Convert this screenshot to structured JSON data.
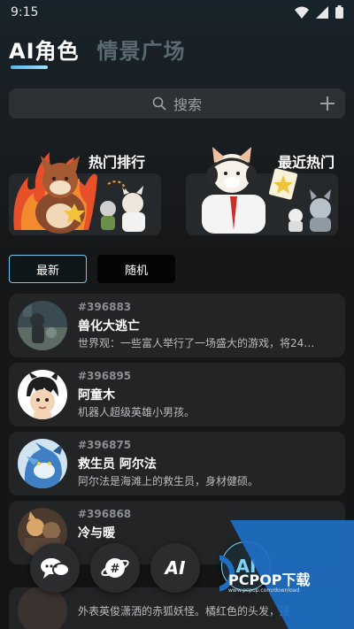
{
  "status_bar": {
    "time": "9:15"
  },
  "tabs": [
    {
      "label": "AI角色",
      "active": true
    },
    {
      "label": "情景广场",
      "active": false
    }
  ],
  "search": {
    "placeholder": "搜索"
  },
  "feature_cards": [
    {
      "title": "热门排行"
    },
    {
      "title": "最近热门"
    }
  ],
  "filters": [
    {
      "label": "最新",
      "active": true
    },
    {
      "label": "随机",
      "active": false
    }
  ],
  "characters": [
    {
      "id": "#396883",
      "name": "兽化大逃亡",
      "desc": "世界观：一些富人举行了一场盛大的游戏，将24…"
    },
    {
      "id": "#396895",
      "name": "阿童木",
      "desc": "机器人超级英雄小男孩。"
    },
    {
      "id": "#396875",
      "name": "救生员 阿尔法",
      "desc": "阿尔法是海滩上的救生员，身材健硕。"
    },
    {
      "id": "#396868",
      "name": "冷与暖",
      "desc": ""
    }
  ],
  "partial_item": {
    "desc": "外表英俊潇洒的赤狐妖怪。橘红色的头发，蓬"
  },
  "dock": {
    "items": [
      {
        "icon": "chat-bubbles-icon"
      },
      {
        "icon": "planet-hash-icon"
      },
      {
        "icon": "ai-outline-icon",
        "label": "AI"
      },
      {
        "icon": "ai-active-icon",
        "label": "AI"
      }
    ]
  },
  "watermark": {
    "text": "PCPOP下载",
    "sub": "www.pcpop.com/download"
  },
  "colors": {
    "accent": "#6fc7ef",
    "card_bg": "#222426",
    "search_bg": "#2d3134",
    "watermark_blue": "#1e6fc4"
  }
}
